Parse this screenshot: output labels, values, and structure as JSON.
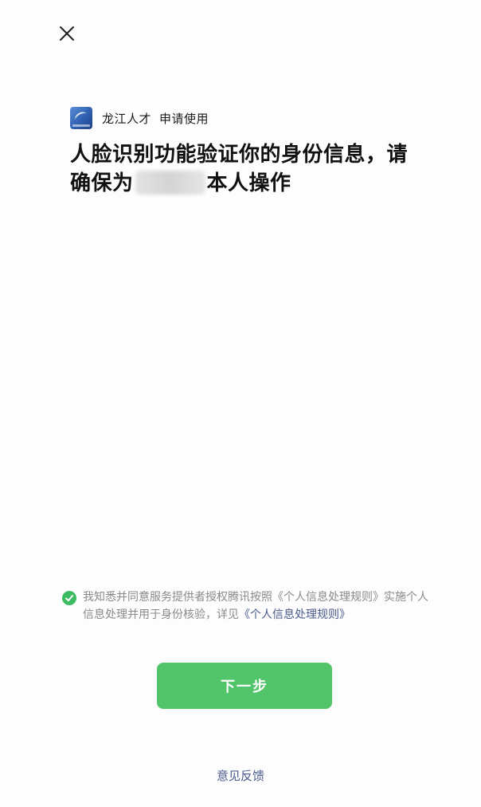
{
  "header": {
    "close_icon": "close-icon"
  },
  "app": {
    "name": "龙江人才",
    "action": "申请使用",
    "logo_icon": "app-logo-icon"
  },
  "headline": {
    "part1": "人脸识别功能验证你的身份信息，请确保为",
    "part2": "本人操作"
  },
  "consent": {
    "checked": true,
    "text_prefix": "我知悉并同意服务提供者授权腾讯按照",
    "link1": "《个人信息处理规则》",
    "text_middle": "实施个人信息处理并用于身份核验，详见",
    "link2": "《个人信息处理规则》"
  },
  "actions": {
    "next_label": "下一步",
    "feedback_label": "意见反馈"
  },
  "colors": {
    "primary_green": "#52c56a",
    "check_green": "#3dbb62",
    "link_blue": "#4a5a8c",
    "text_gray": "#8a8a8a"
  }
}
